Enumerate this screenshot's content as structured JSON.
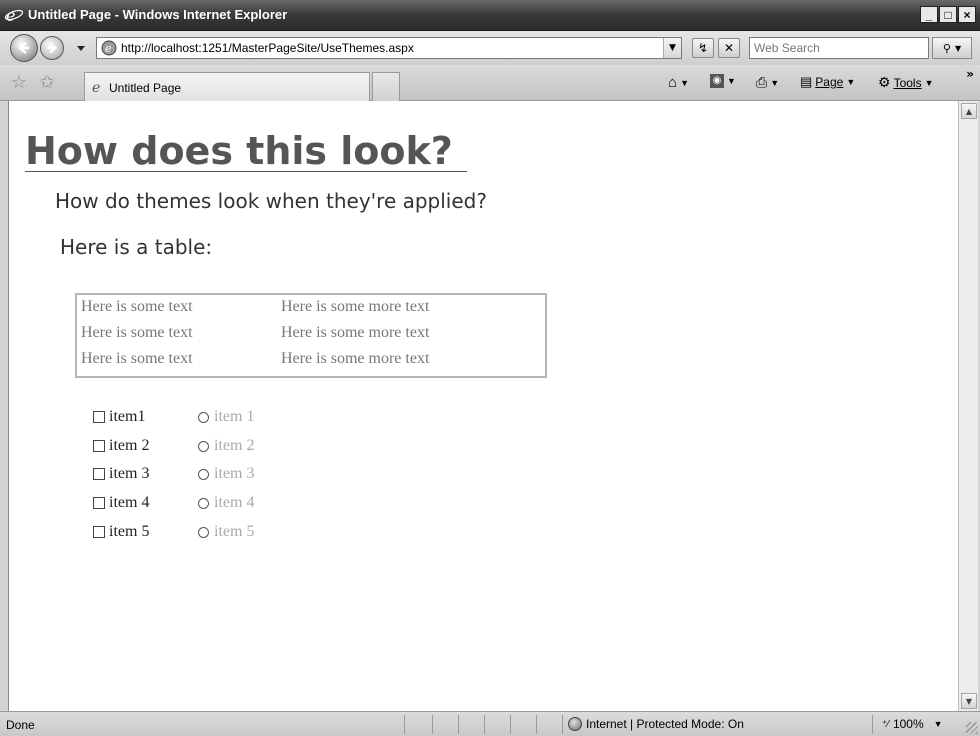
{
  "window": {
    "title": "Untitled Page - Windows Internet Explorer",
    "minimize": "_",
    "maximize": "□",
    "close": "×"
  },
  "addressbar": {
    "url": "http://localhost:1251/MasterPageSite/UseThemes.aspx",
    "search_placeholder": "Web Search"
  },
  "tabs": [
    {
      "label": "Untitled Page"
    }
  ],
  "commandbar": {
    "page_label": "Page",
    "tools_label": "Tools"
  },
  "page": {
    "heading": "How does this look?",
    "subheading": "How do themes look when they're applied?",
    "table_intro": "Here is a table:",
    "table_rows": [
      [
        "Here is some text",
        "Here is some more text"
      ],
      [
        "Here is some text",
        "Here is some more text"
      ],
      [
        "Here is some text",
        "Here is some more text"
      ]
    ],
    "checkbox_items": [
      "item1",
      "item 2",
      "item 3",
      "item 4",
      "item 5"
    ],
    "radio_items": [
      "item 1",
      "item 2",
      "item 3",
      "item 4",
      "item 5"
    ]
  },
  "statusbar": {
    "status": "Done",
    "zone": "Internet | Protected Mode: On",
    "zoom": "100%"
  }
}
